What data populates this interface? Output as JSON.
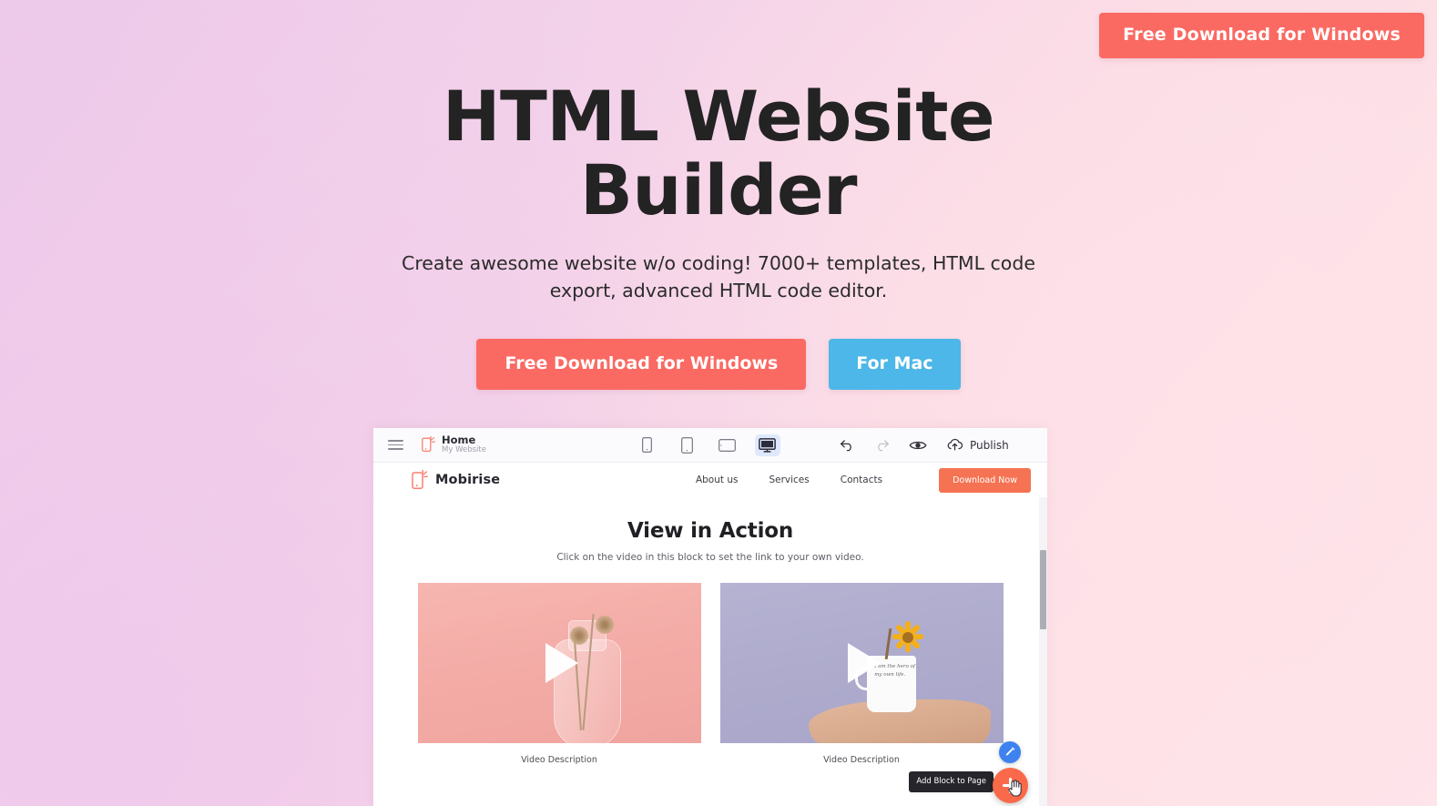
{
  "page": {
    "top_cta_label": "Free Download for Windows"
  },
  "hero": {
    "title_line1": "HTML Website",
    "title_line2": "Builder",
    "subtitle": "Create awesome website w/o coding! 7000+ templates, HTML code export, advanced HTML code editor.",
    "buttons": {
      "windows": "Free Download for Windows",
      "mac": "For Mac"
    }
  },
  "app": {
    "editor_toolbar": {
      "menu_icon": "hamburger-menu-icon",
      "project_logo_icon": "mobirise-logo-icon",
      "project_name": "Home",
      "project_site": "My Website",
      "devices": [
        {
          "name": "phone",
          "icon": "phone-icon",
          "selected": false
        },
        {
          "name": "phablet",
          "icon": "phablet-icon",
          "selected": false
        },
        {
          "name": "tablet",
          "icon": "tablet-icon",
          "selected": false
        },
        {
          "name": "desktop",
          "icon": "desktop-icon",
          "selected": true
        }
      ],
      "undo_icon": "undo-arrow-icon",
      "redo_icon": "redo-arrow-icon",
      "preview_icon": "eye-preview-icon",
      "publish_icon": "cloud-upload-icon",
      "publish_label": "Publish"
    },
    "site_nav": {
      "brand_icon": "mobirise-logo-icon",
      "brand": "Mobirise",
      "links": [
        "About us",
        "Services",
        "Contacts"
      ],
      "cta": "Download Now"
    },
    "canvas": {
      "section_title": "View in Action",
      "section_subtitle": "Click on the video in this block to set the link to your own video.",
      "videos": [
        {
          "caption": "Video Description",
          "play_icon": "play-triangle-icon"
        },
        {
          "caption": "Video Description",
          "play_icon": "play-triangle-icon"
        }
      ],
      "mug_text": "I am the hero of my own life.",
      "edit_fab_icon": "pencil-edit-icon",
      "add_fab_icon": "plus-icon",
      "add_tooltip": "Add Block to Page",
      "cursor_icon": "hand-pointer-cursor-icon"
    }
  },
  "colors": {
    "accent_coral": "#fa6a63",
    "accent_blue": "#4cb7e8",
    "nav_cta_orange": "#f57353",
    "fab_orange": "#fa6a4a",
    "fab_blue": "#3e82f0",
    "heading_dark": "#232323",
    "tooltip_bg": "#25252b"
  }
}
